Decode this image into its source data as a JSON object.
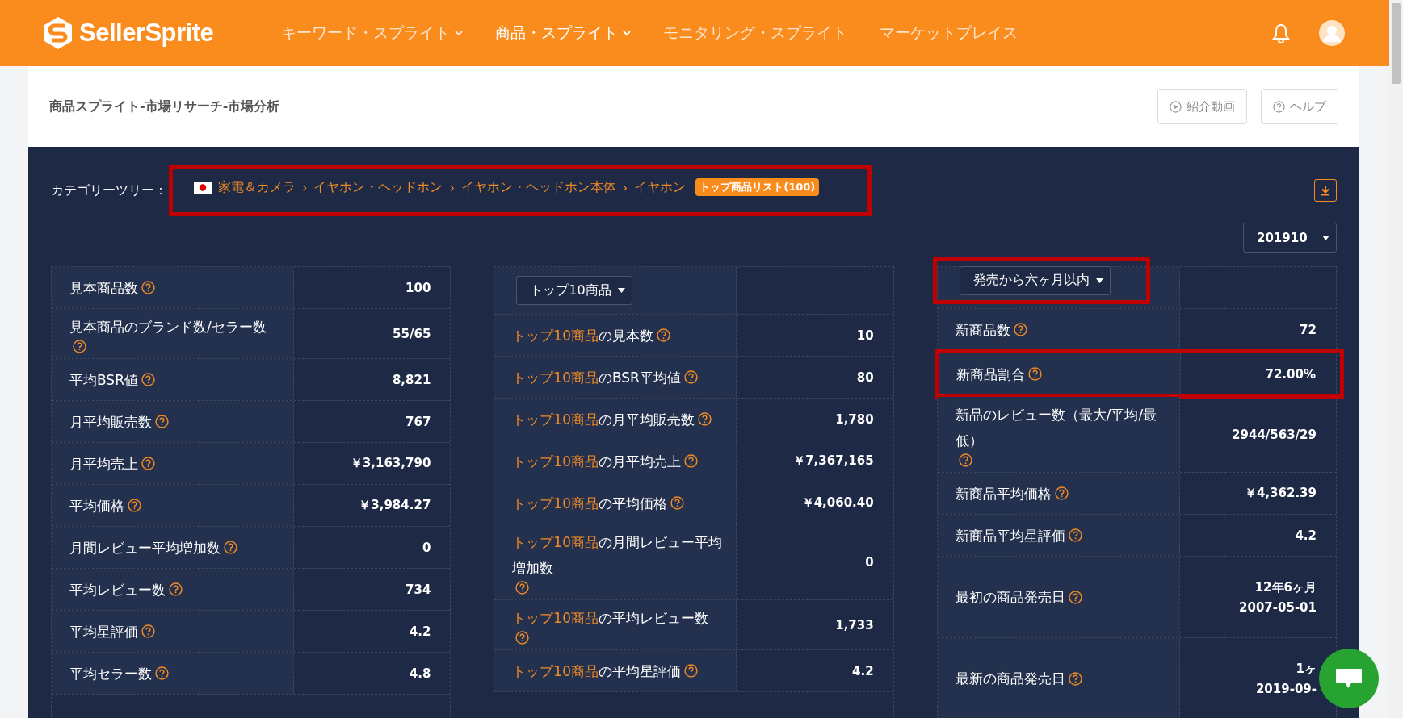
{
  "header": {
    "logo": "SellerSprite",
    "nav": [
      {
        "label": "キーワード・スプライト",
        "selected": false,
        "has_menu": true
      },
      {
        "label": "商品・スプライト",
        "selected": true,
        "has_menu": true
      },
      {
        "label": "モニタリング・スプライト",
        "selected": false,
        "has_menu": false
      },
      {
        "label": "マーケットプレイス",
        "selected": false,
        "has_menu": false
      }
    ]
  },
  "page": {
    "title": "商品スプライト-市場リサーチ-市場分析",
    "buttons": [
      {
        "label": "紹介動画"
      },
      {
        "label": "ヘルプ"
      }
    ]
  },
  "category": {
    "label": "カテゴリーツリー：",
    "path": [
      "家電＆カメラ",
      "イヤホン・ヘッドホン",
      "イヤホン・ヘッドホン本体",
      "イヤホン"
    ],
    "separator": "›",
    "badge": "トップ商品リスト(100)"
  },
  "month_select": "201910",
  "tables": [
    {
      "rows": [
        {
          "label": "見本商品数",
          "value": [
            "100"
          ]
        },
        {
          "label": "見本商品のブランド数/セラー数",
          "value": [
            "55/65"
          ]
        },
        {
          "label": "平均BSR値",
          "value": [
            "8,821"
          ]
        },
        {
          "label": "月平均販売数",
          "value": [
            "767"
          ]
        },
        {
          "label": "月平均売上",
          "value": [
            "￥3,163,790"
          ]
        },
        {
          "label": "平均価格",
          "value": [
            "￥3,984.27"
          ]
        },
        {
          "label": "月間レビュー平均増加数",
          "value": [
            "0"
          ]
        },
        {
          "label": "平均レビュー数",
          "value": [
            "734"
          ]
        },
        {
          "label": "平均星評価",
          "value": [
            "4.2"
          ]
        },
        {
          "label": "平均セラー数",
          "value": [
            "4.8"
          ]
        }
      ]
    },
    {
      "select": "トップ10商品",
      "rows": [
        {
          "prefix": "トップ10商品",
          "label": "の見本数",
          "value": [
            "10"
          ]
        },
        {
          "prefix": "トップ10商品",
          "label": "のBSR平均値",
          "value": [
            "80"
          ]
        },
        {
          "prefix": "トップ10商品",
          "label": "の月平均販売数",
          "value": [
            "1,780"
          ]
        },
        {
          "prefix": "トップ10商品",
          "label": "の月平均売上",
          "value": [
            "￥7,367,165"
          ]
        },
        {
          "prefix": "トップ10商品",
          "label": "の平均価格",
          "value": [
            "￥4,060.40"
          ]
        },
        {
          "prefix": "トップ10商品",
          "label": "の月間レビュー平均増加数",
          "value": [
            "0"
          ]
        },
        {
          "prefix": "トップ10商品",
          "label": "の平均レビュー数",
          "value": [
            "1,733"
          ]
        },
        {
          "prefix": "トップ10商品",
          "label": "の平均星評価",
          "value": [
            "4.2"
          ]
        }
      ]
    },
    {
      "select": "発売から六ヶ月以内",
      "select_highlighted": true,
      "rows": [
        {
          "label": "新商品数",
          "value": [
            "72"
          ],
          "highlighted": false
        },
        {
          "label": "新商品割合",
          "value": [
            "72.00%"
          ],
          "highlighted": true
        },
        {
          "label": "新品のレビュー数（最大/平均/最低）",
          "value": [
            "2944/563/29"
          ],
          "highlighted": false
        },
        {
          "label": "新商品平均価格",
          "value": [
            "￥4,362.39"
          ],
          "highlighted": false
        },
        {
          "label": "新商品平均星評価",
          "value": [
            "4.2"
          ],
          "highlighted": false
        },
        {
          "label": "最初の商品発売日",
          "value": [
            "12年6ヶ月",
            "2007-05-01"
          ],
          "highlighted": false
        },
        {
          "label": "最新の商品発売日",
          "value": [
            "1ヶ",
            "2019-09-"
          ],
          "highlighted": false
        }
      ]
    }
  ]
}
